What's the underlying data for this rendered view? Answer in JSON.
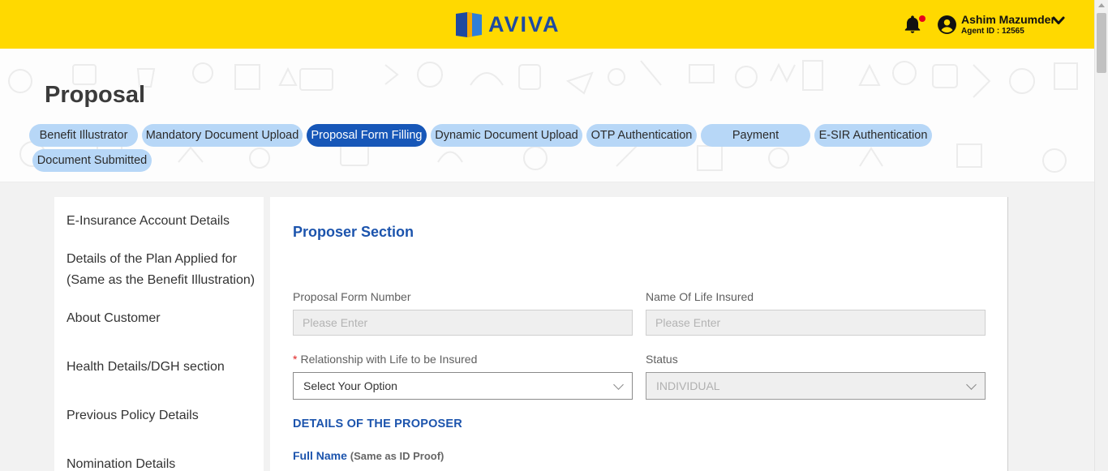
{
  "header": {
    "brand": "AVIVA",
    "user": {
      "name": "Ashim Mazumder",
      "agent_id": "Agent ID : 12565"
    },
    "colors": {
      "bar": "#ffd900",
      "brand_blue": "#1e4aa0",
      "notification_dot": "#e8001c"
    },
    "icons": [
      "aviva-logo",
      "bell-icon",
      "user-avatar-icon",
      "chevron-down-icon"
    ]
  },
  "page": {
    "title": "Proposal",
    "steps": [
      {
        "label": "Benefit Illustrator",
        "active": false
      },
      {
        "label": "Mandatory Document Upload",
        "active": false
      },
      {
        "label": "Proposal Form Filling",
        "active": true
      },
      {
        "label": "Dynamic Document Upload",
        "active": false
      },
      {
        "label": "OTP Authentication",
        "active": false
      },
      {
        "label": "Payment",
        "active": false
      },
      {
        "label": "E-SIR Authentication",
        "active": false
      },
      {
        "label": "Document Submitted",
        "active": false
      }
    ]
  },
  "sidebar": {
    "items": [
      {
        "label": "E-Insurance Account Details"
      },
      {
        "label": "Details of the Plan Applied for"
      },
      {
        "label": "(Same as the Benefit Illustration)"
      },
      {
        "label": "About Customer"
      },
      {
        "label": "Health Details/DGH section"
      },
      {
        "label": "Previous Policy Details"
      },
      {
        "label": "Nomination Details"
      }
    ]
  },
  "form": {
    "section_title": "Proposer Section",
    "proposal_form_number": {
      "label": "Proposal Form Number",
      "placeholder": "Please Enter"
    },
    "life_insured_name": {
      "label": "Name Of Life Insured",
      "placeholder": "Please Enter"
    },
    "relationship": {
      "label": "Relationship with Life to be Insured",
      "required_mark": "*",
      "value": "Select Your Option"
    },
    "status": {
      "label": "Status",
      "value": "INDIVIDUAL"
    },
    "proposer_details_title": "DETAILS OF THE PROPOSER",
    "full_name": {
      "label": "Full Name",
      "hint": "(Same as ID Proof)"
    }
  }
}
